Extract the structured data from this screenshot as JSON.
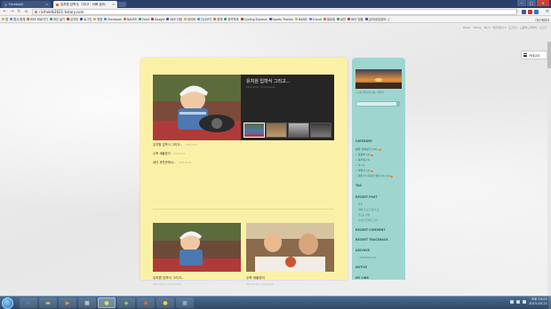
{
  "browser": {
    "tabs": [
      {
        "title": "Facebook",
        "active": false
      },
      {
        "title": "유치원 입학식, 그리고 - 아빠 엄마..",
        "active": true
      }
    ],
    "address": "riclheldk2621.tistory.com",
    "bookmarks": [
      "앱",
      "웹사 옹체",
      "BEE 바로가기",
      "최신 읽기",
      "유의미",
      "로그인",
      "정월",
      "Facebook",
      "NAVER",
      "Feed",
      "Google",
      "BEE 다음",
      "네이버",
      "다시보기",
      "현체",
      "위키백과",
      "Cycling Express",
      "Sports Tracker",
      "BAND",
      "iCloud",
      "팔로워",
      "로빈",
      "BEE 정물",
      "[유타공유정보..]"
    ],
    "bookmarks_other": "기타 북마크"
  },
  "page": {
    "top_links": [
      "Daum",
      "Tistory",
      "My ▾",
      "최근글보기 ▾",
      "로그인 ▾",
      "도움말/고객센터",
      "로그인"
    ],
    "login_button": "카테고리",
    "breadcrumbs": [
      "홈",
      "태그",
      "미디어로그",
      "위치로그",
      "방명록",
      "사용자 안내 가이드"
    ],
    "featured": {
      "title": "유치원 입학식 그리고...",
      "subtitle": "2015.03.21 | 0 Comments"
    },
    "posts": [
      {
        "title": "유치원 입학식 그리고...",
        "meta": "2015.03.21"
      },
      {
        "title": "수목 세돌맞이",
        "meta": "2015.03.10"
      },
      {
        "title": "내년 과천관에서...",
        "meta": "2015.02.28"
      }
    ],
    "cards": [
      {
        "title": "유치원 입학식 그리고...",
        "meta": "2015.03.21 | 0 Comments"
      },
      {
        "title": "수목 세돌맞이",
        "meta": "2015.03.10 | 0 Comments"
      }
    ]
  },
  "sidebar": {
    "profile_caption": "도시한 행복보관 Ol는 행복거",
    "headings": {
      "category": "CATEGORY",
      "tag": "TAG",
      "recent_post": "RECENT POST",
      "recent_comment": "RECENT COMMENT",
      "recent_trackback": "RECENT TRACKBACK",
      "archive": "ARCHIVE",
      "notice": "NOTICE",
      "my_link": "MY LINK"
    },
    "categories": [
      {
        "label": "분류 전체보기 (13)",
        "new": true
      },
      {
        "label": "• 경공부 (4)",
        "new": true
      },
      {
        "label": "• 육아일 (3)",
        "new": false
      },
      {
        "label": "• 사 (1)",
        "new": false
      },
      {
        "label": "• 여행사 (4)",
        "new": true
      },
      {
        "label": "• 외좌 Hi 이야기 없이 (2) (1)",
        "new": true
      }
    ],
    "recent_posts": [
      "유치",
      "대에 기 보고 실감 로",
      "방조도 실망",
      "수작님 돌맞이 그리."
    ],
    "archive": [
      "• 2015/03 (13)"
    ],
    "links": [
      "• 엄마따라 생활하지",
      "• 유치원 다니",
      "• 살로교 사용"
    ]
  },
  "taskbar": {
    "clock_time": "오후 10:01",
    "clock_date": "2015-03-21"
  },
  "colors": {
    "content_bg": "#fbf1a6",
    "sidebar_bg": "#9ed6cf",
    "taskbar": "#3b5a7c"
  }
}
